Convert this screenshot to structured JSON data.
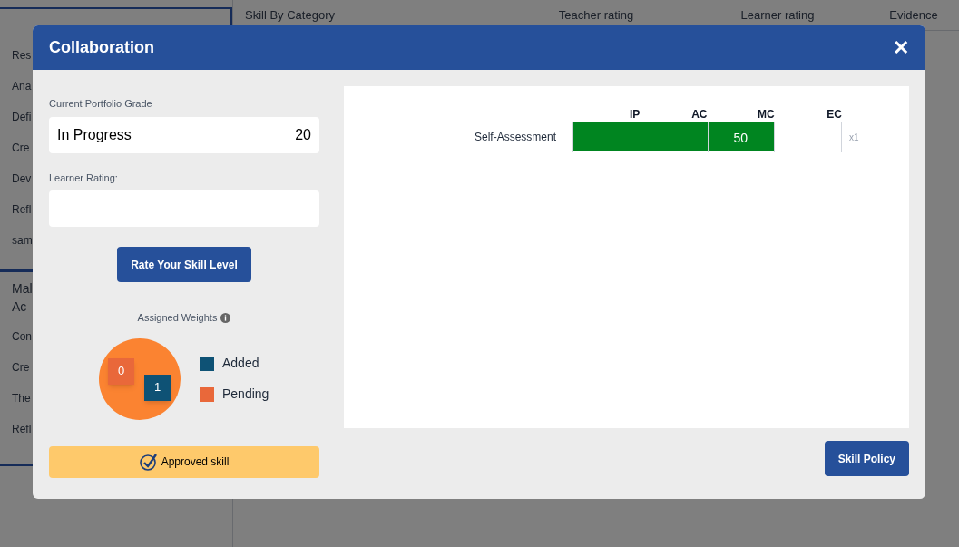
{
  "background": {
    "sidebar": [
      {
        "items": [
          "Res",
          "Ana",
          "Defi",
          "Cre",
          "Dev",
          "Refl",
          "sam"
        ]
      },
      {
        "title_lines": [
          "Mal",
          "Ac"
        ],
        "items": [
          "Con",
          "Cre",
          "The",
          "Refl"
        ]
      }
    ],
    "table_columns": [
      "Skill By Category",
      "Teacher rating",
      "Learner rating",
      "Evidence"
    ]
  },
  "modal": {
    "title": "Collaboration",
    "close": "✕",
    "grade_label": "Current Portfolio Grade",
    "grade_value": "In Progress",
    "grade_score": "20",
    "learner_label": "Learner Rating:",
    "rate_button": "Rate Your Skill Level",
    "weights_title": "Assigned Weights",
    "weights": [
      {
        "value": "0",
        "color": "#e9683a"
      },
      {
        "value": "1",
        "color": "#0e5275"
      }
    ],
    "legend": [
      {
        "label": "Added",
        "color": "#0e5275"
      },
      {
        "label": "Pending",
        "color": "#e9683a"
      }
    ],
    "approved": "Approved skill",
    "scale": [
      "IP",
      "AC",
      "MC",
      "EC"
    ],
    "assessments": [
      {
        "label": "Self-Assessment",
        "value": "50",
        "level": 0.75,
        "multiplier": "x1"
      }
    ],
    "policy_button": "Skill Policy"
  }
}
